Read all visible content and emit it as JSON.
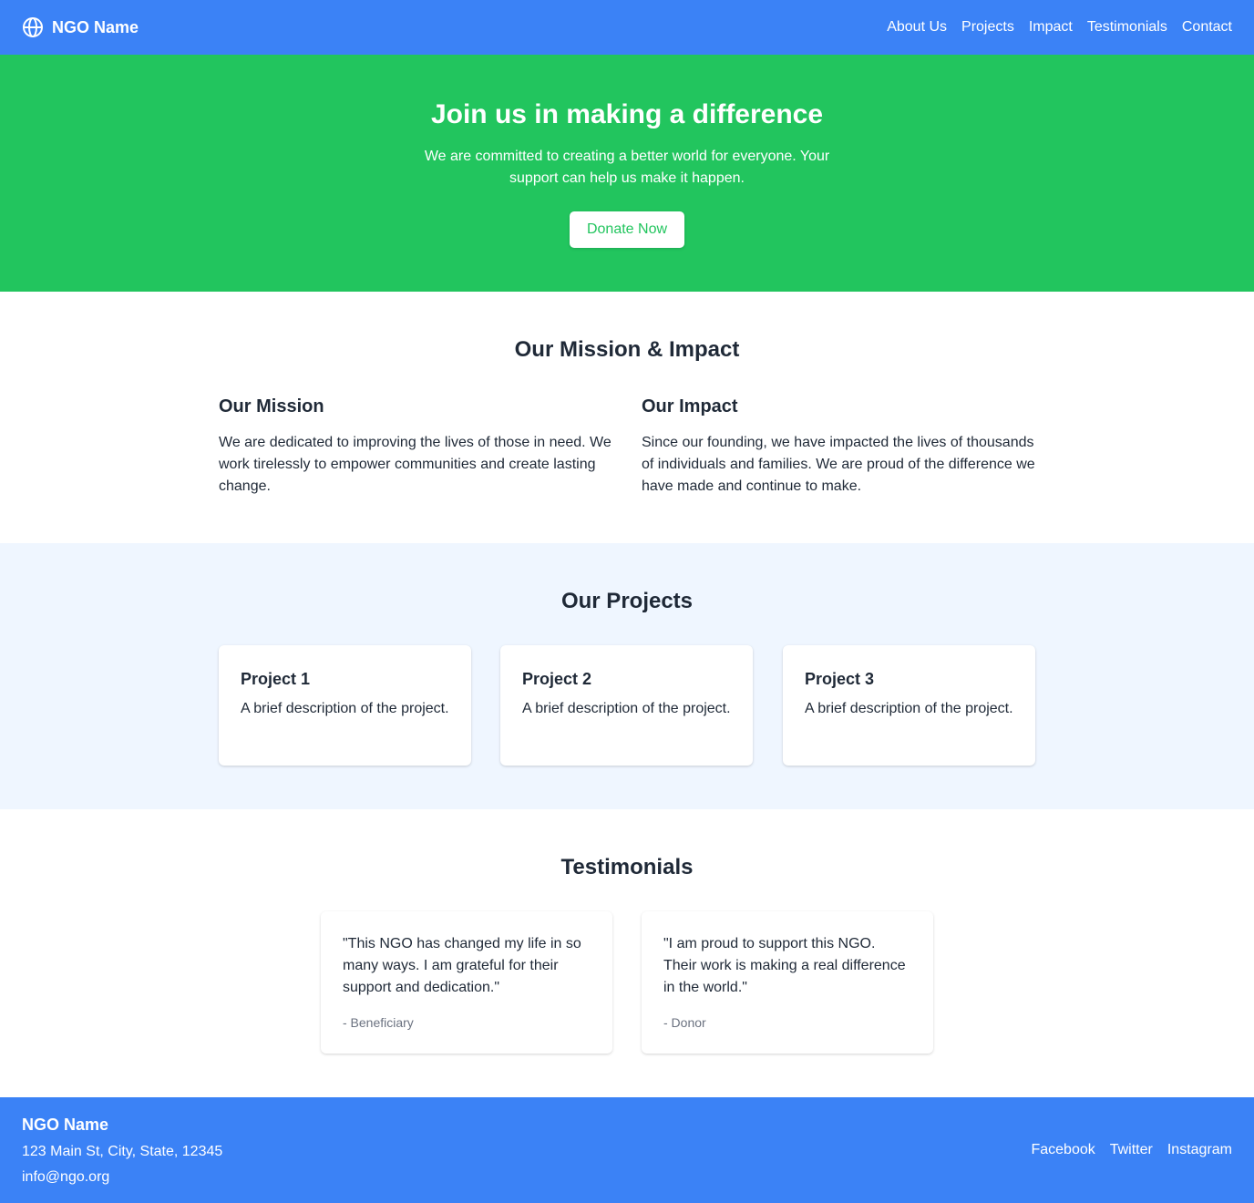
{
  "nav": {
    "brand": "NGO Name",
    "brand_icon": "globe-icon",
    "links": [
      "About Us",
      "Projects",
      "Impact",
      "Testimonials",
      "Contact"
    ]
  },
  "hero": {
    "title": "Join us in making a difference",
    "subtitle": "We are committed to creating a better world for everyone. Your support can help us make it happen.",
    "cta": "Donate Now"
  },
  "mission": {
    "title": "Our Mission & Impact",
    "mission_title": "Our Mission",
    "mission_text": "We are dedicated to improving the lives of those in need. We work tirelessly to empower communities and create lasting change.",
    "impact_title": "Our Impact",
    "impact_text": "Since our founding, we have impacted the lives of thousands of individuals and families. We are proud of the difference we have made and continue to make."
  },
  "projects": {
    "title": "Our Projects",
    "items": [
      {
        "title": "Project 1",
        "text": "A brief description of the project."
      },
      {
        "title": "Project 2",
        "text": "A brief description of the project."
      },
      {
        "title": "Project 3",
        "text": "A brief description of the project."
      }
    ]
  },
  "testimonials": {
    "title": "Testimonials",
    "items": [
      {
        "quote": "\"This NGO has changed my life in so many ways. I am grateful for their support and dedication.\"",
        "author": "- Beneficiary"
      },
      {
        "quote": "\"I am proud to support this NGO. Their work is making a real difference in the world.\"",
        "author": "- Donor"
      }
    ]
  },
  "footer": {
    "name": "NGO Name",
    "address": "123 Main St, City, State, 12345",
    "email": "info@ngo.org",
    "social": [
      "Facebook",
      "Twitter",
      "Instagram"
    ]
  },
  "colors": {
    "primary": "#3b82f6",
    "hero": "#22c55e",
    "projects_bg": "#eff6ff",
    "text": "#1f2937",
    "muted": "#6b7280"
  }
}
